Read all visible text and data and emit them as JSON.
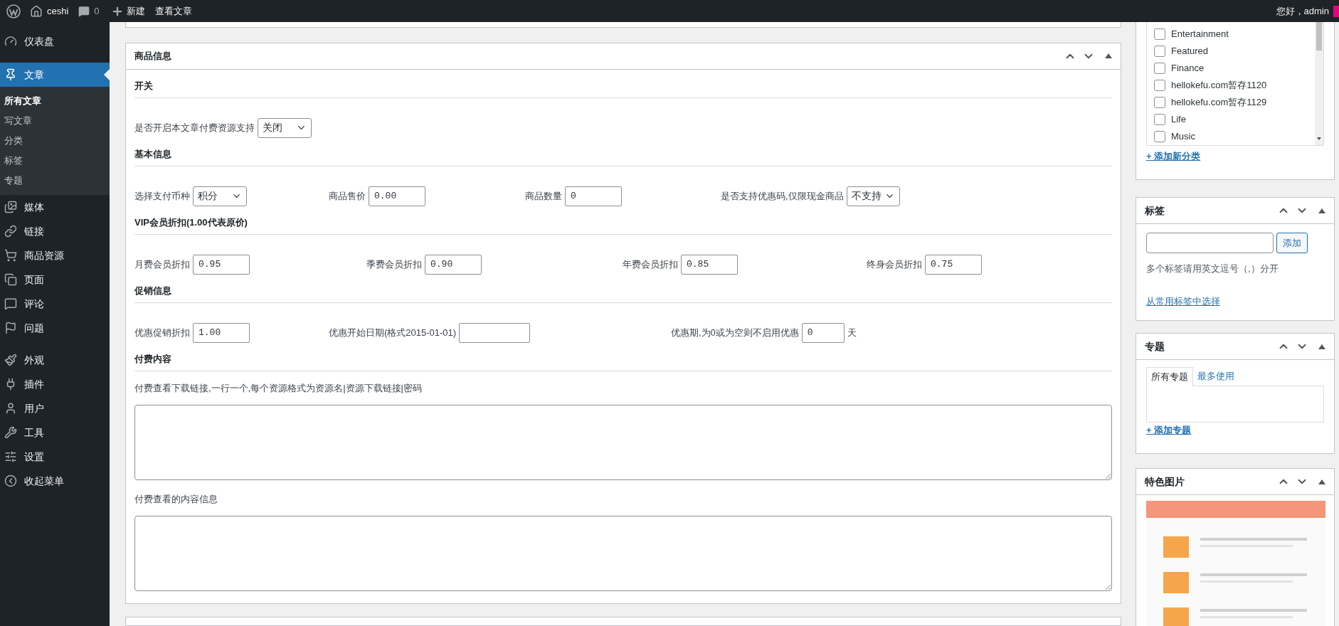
{
  "admin_bar": {
    "site_name": "ceshi",
    "comment_count": "0",
    "new_label": "新建",
    "view_post": "查看文章",
    "greeting": "您好，admin"
  },
  "sidebar": {
    "groups": [
      {
        "items": [
          {
            "label": "仪表盘",
            "selected": false
          }
        ]
      },
      {
        "items": [
          {
            "label": "文章",
            "selected": true,
            "children": [
              {
                "label": "所有文章",
                "selected": true
              },
              {
                "label": "写文章",
                "selected": false
              },
              {
                "label": "分类",
                "selected": false
              },
              {
                "label": "标签",
                "selected": false
              },
              {
                "label": "专题",
                "selected": false
              }
            ]
          },
          {
            "label": "媒体",
            "selected": false
          },
          {
            "label": "链接",
            "selected": false
          },
          {
            "label": "商品资源",
            "selected": false
          },
          {
            "label": "页面",
            "selected": false
          },
          {
            "label": "评论",
            "selected": false
          },
          {
            "label": "问题",
            "selected": false
          }
        ]
      },
      {
        "items": [
          {
            "label": "外观",
            "selected": false
          },
          {
            "label": "插件",
            "selected": false
          },
          {
            "label": "用户",
            "selected": false
          },
          {
            "label": "工具",
            "selected": false
          },
          {
            "label": "设置",
            "selected": false
          },
          {
            "label": "收起菜单",
            "selected": false
          }
        ]
      }
    ]
  },
  "product_panel": {
    "title": "商品信息",
    "sections": [
      {
        "heading": "开关",
        "fields": [
          {
            "kind": "select",
            "label": "是否开启本文章付费资源支持",
            "value": "关闭"
          }
        ]
      },
      {
        "heading": "基本信息",
        "fields": [
          {
            "kind": "select",
            "label": "选择支付币种",
            "value": "积分"
          },
          {
            "kind": "input",
            "label": "商品售价",
            "value": "0.00"
          },
          {
            "kind": "input",
            "label": "商品数量",
            "value": "0"
          },
          {
            "kind": "select",
            "label": "是否支持优惠码,仅限现金商品",
            "value": "不支持"
          }
        ]
      },
      {
        "heading": "VIP会员折扣(1.00代表原价)",
        "fields": [
          {
            "kind": "input",
            "label": "月费会员折扣",
            "value": "0.95"
          },
          {
            "kind": "input",
            "label": "季费会员折扣",
            "value": "0.90"
          },
          {
            "kind": "input",
            "label": "年费会员折扣",
            "value": "0.85"
          },
          {
            "kind": "input",
            "label": "终身会员折扣",
            "value": "0.75"
          }
        ]
      },
      {
        "heading": "促销信息",
        "fields": [
          {
            "kind": "input",
            "label": "优惠促销折扣",
            "value": "1.00"
          },
          {
            "kind": "input",
            "label": "优惠开始日期(格式2015-01-01)"
          },
          {
            "kind": "input",
            "label": "优惠期,为0或为空则不启用优惠",
            "value": "0",
            "suffix": "天"
          }
        ]
      },
      {
        "heading": "付费内容",
        "fields": [
          {
            "kind": "textarea",
            "label": "付费查看下载链接,一行一个,每个资源格式为资源名|资源下载链接|密码"
          },
          {
            "kind": "textarea",
            "label": "付费查看的内容信息"
          }
        ]
      }
    ]
  },
  "categories": {
    "items": [
      {
        "label": "Entertainment",
        "checked": false
      },
      {
        "label": "Featured",
        "checked": false
      },
      {
        "label": "Finance",
        "checked": false
      },
      {
        "label": "hellokefu.com暂存1120",
        "checked": false
      },
      {
        "label": "hellokefu.com暂存1129",
        "checked": false
      },
      {
        "label": "Life",
        "checked": false
      },
      {
        "label": "Music",
        "checked": false
      }
    ],
    "add_link": "+ 添加新分类"
  },
  "tags": {
    "title": "标签",
    "add_button": "添加",
    "hint": "多个标签请用英文逗号（,）分开",
    "choose_link": "从常用标签中选择"
  },
  "topics": {
    "title": "专题",
    "tabs": [
      {
        "label": "所有专题",
        "selected": true
      },
      {
        "label": "最多使用",
        "selected": false
      }
    ],
    "add_link": "+ 添加专题"
  },
  "featured_image": {
    "title": "特色图片"
  }
}
